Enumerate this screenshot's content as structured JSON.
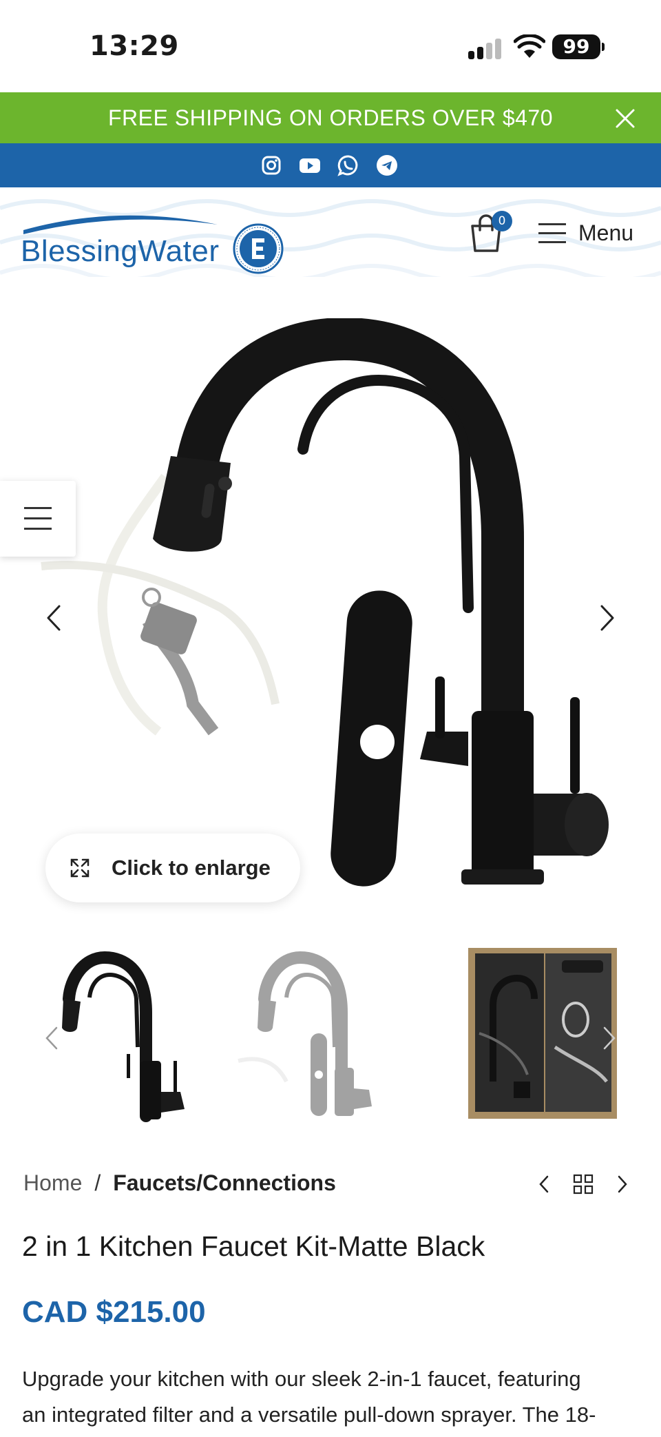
{
  "status_bar": {
    "time": "13:29",
    "battery": "99",
    "icons": [
      "signal-icon",
      "wifi-icon",
      "battery-icon"
    ]
  },
  "announcement": {
    "text": "FREE SHIPPING ON ORDERS OVER $470",
    "close_icon": "close-icon",
    "background": "#6cb52d"
  },
  "social": {
    "icons": [
      "instagram-icon",
      "youtube-icon",
      "whatsapp-icon",
      "telegram-icon"
    ],
    "background": "#1d64a9"
  },
  "header": {
    "logo_text": "BlessingWater",
    "cart_count": "0",
    "menu_label": "Menu"
  },
  "gallery": {
    "enlarge_label": "Click to enlarge",
    "thumbnails": [
      "faucet-black",
      "faucet-kit-gray",
      "faucet-box-kit"
    ]
  },
  "breadcrumb": {
    "home": "Home",
    "separator": "/",
    "current": "Faucets/Connections"
  },
  "product": {
    "title": "2 in 1 Kitchen Faucet Kit-Matte Black",
    "price": "CAD $215.00",
    "description_line1": "Upgrade your kitchen with our sleek 2-in-1 faucet, featuring",
    "description_line2": "an integrated filter and a versatile pull-down sprayer. The 18-"
  },
  "colors": {
    "brand_blue": "#1d64a9",
    "brand_green": "#6cb52d"
  }
}
